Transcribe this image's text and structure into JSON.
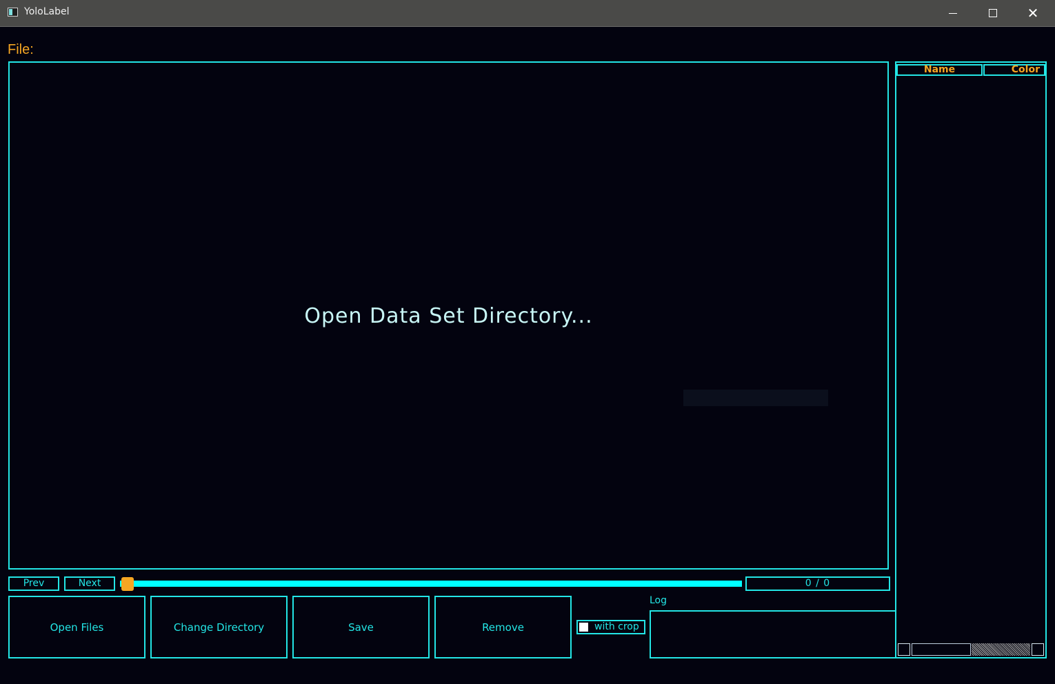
{
  "window": {
    "title": "YoloLabel"
  },
  "file": {
    "label": "File:"
  },
  "canvas": {
    "message": "Open Data Set Directory..."
  },
  "class_table": {
    "columns": [
      "Name",
      "Color"
    ]
  },
  "navigation": {
    "prev_label": "Prev",
    "next_label": "Next",
    "slider_position": 0,
    "counter": "0 / 0"
  },
  "actions": {
    "open_files": "Open Files",
    "change_directory": "Change Directory",
    "save": "Save",
    "remove": "Remove"
  },
  "crop": {
    "label": "with crop",
    "checked": false
  },
  "log": {
    "label": "Log",
    "content": ""
  },
  "colors": {
    "accent": "#23e6e6",
    "highlight": "#f5a623",
    "background": "#03030f"
  }
}
